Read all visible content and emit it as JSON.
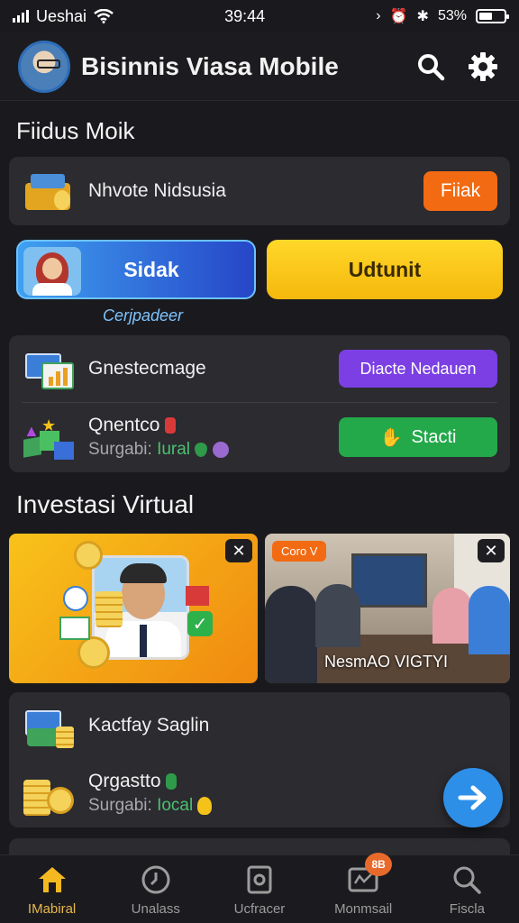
{
  "status": {
    "carrier": "Ueshai",
    "time": "39:44",
    "battery": "53%",
    "battery_level": 0.53
  },
  "header": {
    "title": "Bisinnis Viasa Mobile"
  },
  "section1": {
    "title": "Fiidus Moik"
  },
  "card1": {
    "label": "Nhvote Nidsusia",
    "button": "Fiiak",
    "button_color": "#f26a12"
  },
  "actions": {
    "primary": "Sidak",
    "secondary": "Udtunit",
    "caption": "Cerjpadeer"
  },
  "card2": {
    "row1_label": "Gnestecmage",
    "row1_button": "Diacte Nedauen",
    "row2_label": "Qnentco",
    "row2_sub": "Surgabi:",
    "row2_sub_value": "Iural",
    "row2_button": "Stacti"
  },
  "section2": {
    "title": "Investasi Virtual"
  },
  "promo2": {
    "tag": "Coro V",
    "caption": "NesmAO VIGTYI"
  },
  "card3": {
    "row1_label": "Kactfay Saglin",
    "row2_label": "Qrgastto",
    "row2_sub": "Surgabi:",
    "row2_sub_value": "Iocal"
  },
  "nav": {
    "items": [
      {
        "label": "IMabiral"
      },
      {
        "label": "Unalass"
      },
      {
        "label": "Ucfracer"
      },
      {
        "label": "Monmsail",
        "badge": "8B"
      },
      {
        "label": "Fiscla"
      }
    ]
  },
  "colors": {
    "accent_blue": "#2e8fe8",
    "accent_orange": "#f26a12",
    "accent_yellow": "#f5c21a",
    "accent_purple": "#7b3fe4",
    "accent_green": "#23a84a"
  }
}
